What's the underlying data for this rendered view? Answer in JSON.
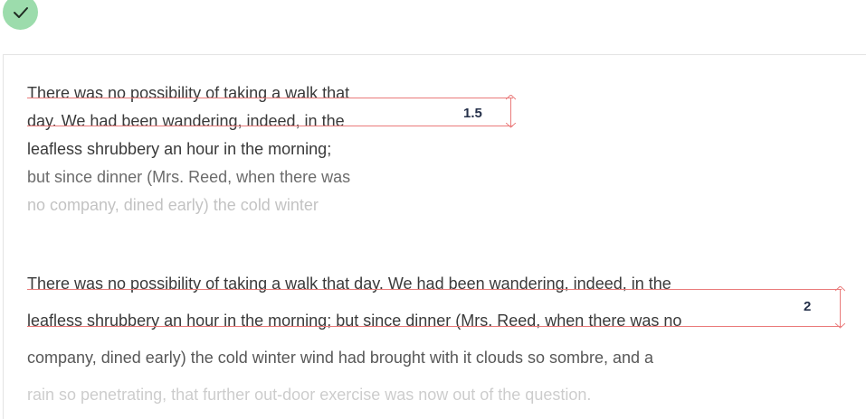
{
  "status": {
    "icon": "checkmark-icon",
    "color": "#9cdcac"
  },
  "samples": [
    {
      "line_height_label": "1.5",
      "lines": [
        "There was no possibility of taking a walk that",
        "day. We had been wandering, indeed, in the",
        "leafless shrubbery an hour in the morning;",
        "but since dinner (Mrs. Reed, when there was",
        "no company, dined early) the cold winter"
      ]
    },
    {
      "line_height_label": "2",
      "lines": [
        "There was no possibility of taking a walk that day. We had been wandering, indeed, in the",
        "leafless shrubbery an hour in the morning; but since dinner (Mrs. Reed, when there was no",
        "company, dined early) the cold winter wind had brought with it clouds so sombre, and a",
        "rain so penetrating, that further out-door exercise was now out of the question."
      ]
    }
  ],
  "colors": {
    "text": "#3a3a3a",
    "guide": "#ea7a7a",
    "label": "#25304a",
    "border": "#e4e4e4"
  }
}
